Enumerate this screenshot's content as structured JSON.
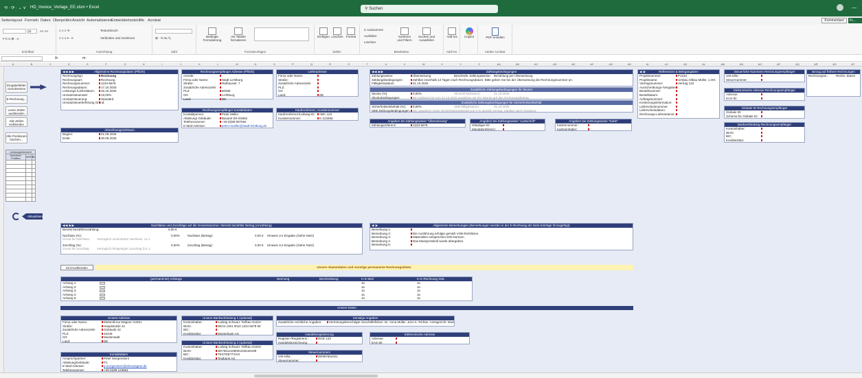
{
  "window": {
    "quick_access": "⟲ · ⟳ · ⌄ ∨",
    "filename": "HD_Invoice_Vorlage_EE.xlsm • Excel",
    "search_placeholder": "Suchen",
    "minimize": "—"
  },
  "menu": [
    "Seitenlayout",
    "Formeln",
    "Daten",
    "Überprüfen",
    "Ansicht",
    "Automatisieren",
    "Entwicklertools",
    "Hilfe",
    "Acrobat"
  ],
  "menu_right": {
    "kommentare": "Kommentare",
    "freigeben": "Fr..."
  },
  "ribbon": {
    "groups": [
      {
        "label": "Schriftart"
      },
      {
        "label": "Ausrichtung"
      },
      {
        "label": "Zahl"
      },
      {
        "label": "Formatvorlagen"
      },
      {
        "label": "Zellen"
      },
      {
        "label": "Bearbeiten"
      },
      {
        "label": "Add-Ins"
      },
      {
        "label": "Adobe Acrobat"
      }
    ],
    "font_size": "11",
    "textumbruch": "Textumbruch",
    "verbinden": "Verbinden und zentrieren",
    "bedingte": "Bedingte Formatierung",
    "als_tabelle": "Als Tabelle formatieren",
    "einfuegen": "Einfügen",
    "loeschen": "Löschen",
    "format": "Format",
    "autosumme": "Autosumme",
    "ausfuellen": "Ausfüllen",
    "loeschen2": "Löschen",
    "sortieren": "Sortieren und Filtern",
    "suchen": "Suchen und Auswählen",
    "addins": "Add-Ins",
    "copilot": "Copilot",
    "pdf": "PDF erstellen"
  },
  "formula": {
    "namebox": "",
    "fx": "fx",
    "value": "m"
  },
  "columns": [
    "A",
    "B",
    "C",
    "D",
    "E",
    "F",
    "G",
    "H",
    "I",
    "J",
    "K",
    "L",
    "M",
    "N",
    "O",
    "P",
    "Q",
    "R",
    "S",
    "T",
    "U",
    "V",
    "W",
    "X",
    "Y",
    "Z",
    "AA",
    "AB",
    "AC",
    "AD",
    "AE",
    "AF",
    "AG",
    "AH",
    "AI",
    "AJ",
    "AK",
    "AL",
    "AM",
    "AN",
    "AO",
    "AP",
    "AQ",
    "AR",
    "AS",
    "AT"
  ],
  "sidebuttons": {
    "eingabefelder": "Eingabefelder zurücksetzen",
    "erechnung": "E-Rechnung...",
    "leere_zeilen": "Leere Zeilen ausblenden",
    "alle_zeilen": "Alle Zeilen einblenden",
    "alle_positionen": "Alle Positionen löschen...",
    "aktualisieren": "Aktualisieren"
  },
  "leistung_table": {
    "title": "Leistungsübersicht",
    "headers": [
      "Gebühren Position",
      "VBR",
      "Bk"
    ]
  },
  "allgemeine": {
    "title": "Allgemeine Rechnungsdaten (Pflicht)",
    "rows": [
      {
        "label": "Rechnungstyp:",
        "value": "Rechnung",
        "bold": true
      },
      {
        "label": "Rechnungsart:",
        "value": "Rechnung"
      },
      {
        "label": "Rechnungsnummer:",
        "value": "1234-5678"
      },
      {
        "label": "Rechnungsdatum:",
        "value": "17.10.2025"
      },
      {
        "label": "Leistungs-/Lieferdatum:",
        "value": "16.10.2025"
      },
      {
        "label": "Umsatzsteuersatz:",
        "value": "19,00%"
      },
      {
        "label": "Umsatzsteuerung:",
        "value": "Standard"
      },
      {
        "label": "Umsatzsteuerbefreiung Grund:",
        "value": ""
      }
    ]
  },
  "abrechnung": {
    "title": "Abrechnungszeitraum",
    "rows": [
      {
        "label": "Beginn:",
        "value": "01.09.2025"
      },
      {
        "label": "Ende:",
        "value": "30.09.2025"
      }
    ]
  },
  "empfaenger": {
    "title": "Rechnungsempfänger Adresse (Pflicht)",
    "rows": [
      {
        "label": "Anrede:",
        "value": ""
      },
      {
        "label": "Firma oder Name:",
        "value": "Stadt Lichtburg"
      },
      {
        "label": "Straße:",
        "value": "Rathausstr. 7"
      },
      {
        "label": "Zusätzliche Adresszeile:",
        "value": ""
      },
      {
        "label": "PLZ:",
        "value": "60486"
      },
      {
        "label": "Ort:",
        "value": "Lichtburg"
      },
      {
        "label": "Land:",
        "value": "DE"
      }
    ]
  },
  "empf_kontakt": {
    "title": "Rechnungsempfänger Kontaktdaten",
    "rows": [
      {
        "label": "Kontaktperson:",
        "value": "Peter Müller"
      },
      {
        "label": "Abteilung/ Gebäude:",
        "value": "Bauamt EK-E5652"
      },
      {
        "label": "Telefonnummer:",
        "value": "+49 (0)89 987654"
      },
      {
        "label": "E-Mail-Adresse:",
        "value": "peter.mueller@stadt-lichtburg.de",
        "link": true
      }
    ]
  },
  "liefer": {
    "title": "Lieferadresse",
    "rows": [
      {
        "label": "Firma oder Name:",
        "value": ""
      },
      {
        "label": "Straße:",
        "value": ""
      },
      {
        "label": "Zusätzliche Adresszeile:",
        "value": ""
      },
      {
        "label": "PLZ:",
        "value": ""
      },
      {
        "label": "Ort:",
        "value": ""
      },
      {
        "label": "Land:",
        "value": "DE"
      }
    ]
  },
  "kaeuferref": {
    "title": "Käuferreferenz, Kundennummer",
    "rows": [
      {
        "label": "Käuferreferenz/Leitweg-ID:",
        "value": "ABC-123"
      },
      {
        "label": "Kundennummer:",
        "value": "K-123456"
      }
    ]
  },
  "zahlung": {
    "title": "Zahlungsbedingungen",
    "rows": [
      {
        "label": "Zahlungsweise:",
        "value": "Überweisung",
        "extra_label": "Beschreib. Zahlungsweise:",
        "extra": "Bezahlung per Überweisung"
      },
      {
        "label": "Zahlungsbedingungen:",
        "value": "Zahlbar innerhalb 14 Tagen nach Rechnungsdatum. Bitte geben Sie bei der Überweisung die Rechnungsnummer an."
      },
      {
        "label": "Fälligkeitsdatum:",
        "value": "31.10.2025"
      }
    ]
  },
  "skonto": {
    "title": "Zusätzliche Zahlungsbedingungen für Skonto",
    "rows": [
      {
        "label": "Skonto (%):",
        "value": "0,00%",
        "grey": "Skontofrist(Datum):",
        "grey2": "31.10.2025"
      },
      {
        "label": "Skontobedingungen:",
        "value": "Bei Zahlung bis zum 31.10.2025 gewähren wir 0% Skonto auf den Rechnungsbetrag.",
        "greyval": true
      }
    ]
  },
  "sicherheit": {
    "title": "Zusätzliche Zahlungsbedingungen für Sicherheitseinbehalt",
    "rows": [
      {
        "label": "Sicherheitseinbehalt (%):",
        "value": "0,00%",
        "grey": "SEB fällig(Datum):",
        "grey2": "31.10.2025"
      },
      {
        "label": "SEB Zahlungsbedingungen:",
        "value": "Wir gewähren einen Sicherheitseinbehalt von 0 % gemäß Vertrag. Zahlbar nach Abnahme.",
        "greyval": true
      }
    ]
  },
  "ueberweisung": {
    "title": "Angaben bei Zahlungsweise \"Überweisung\"",
    "rows": [
      {
        "label": "Zahlungsreferenz:",
        "value": "1234-5678"
      }
    ]
  },
  "lastschrift": {
    "title": "Angaben bei Zahlungsweise \"Lastschrift\"",
    "rows": [
      {
        "label": "Gläubiger-ID:",
        "value": ""
      },
      {
        "label": "Mandatsreferenz:",
        "value": ""
      }
    ]
  },
  "karte": {
    "title": "Angaben bei Zahlungsweise \"Karte\"",
    "rows": [
      {
        "label": "Kartennummer:",
        "value": ""
      },
      {
        "label": "Karteninhaber:",
        "value": ""
      }
    ]
  },
  "referenzen": {
    "title": "Referenzen & Belegangaben",
    "rows": [
      {
        "label": "Projektnummer:",
        "value": "P1234"
      },
      {
        "label": "Projektname:",
        "value": "Umbau Altbau Müller, 1.OG"
      },
      {
        "label": "Vertragsnummer:",
        "value": "Vertrag 123"
      },
      {
        "label": "Ausschreibungs-/Vergabenr.:",
        "value": ""
      },
      {
        "label": "Bestellnummer:",
        "value": ""
      },
      {
        "label": "Bestelldatum:",
        "value": ""
      },
      {
        "label": "Auftragsnummer:",
        "value": ""
      },
      {
        "label": "Kontierungsinformation:",
        "value": ""
      },
      {
        "label": "Lieferscheinnummer:",
        "value": ""
      },
      {
        "label": "Lieferscheindatum:",
        "value": ""
      },
      {
        "label": "Rechnungs-Lieferantennr.:",
        "value": ""
      }
    ]
  },
  "steuernummern": {
    "title": "Steuerliche Nummern Rechnungsempfänger",
    "rows": [
      {
        "label": "USt-IdNr.:",
        "value": ""
      },
      {
        "label": "Steuernummer:",
        "value": ""
      }
    ]
  },
  "elektronische": {
    "title": "Elektronische Adresse Rechnungsempfänger",
    "rows": [
      {
        "label": "Adresse:",
        "value": ""
      },
      {
        "label": "EAS-ID:",
        "value": ""
      }
    ]
  },
  "globalid": {
    "title": "Globale ID Rechnungsempfänger",
    "rows": [
      {
        "label": "Globale ID:",
        "value": ""
      },
      {
        "label": "Schema für Globale ID:",
        "value": ""
      }
    ]
  },
  "bankverbindung_empf": {
    "title": "Bankverbindung Rechnungsempfänger",
    "rows": [
      {
        "label": "Kontoinhaber:",
        "value": ""
      },
      {
        "label": "IBAN:",
        "value": ""
      },
      {
        "label": "BIC:",
        "value": ""
      },
      {
        "label": "Kreditinstitut:",
        "value": ""
      }
    ]
  },
  "bezug": {
    "title": "Bezug auf frühere Rechnungen",
    "headers": [
      "Rechnungsnr.:",
      "Rechn.-datum"
    ]
  },
  "nachlass": {
    "title": "Nachlässe und Zuschläge auf die Gesamtsumme / Bereits bezahlter Betrag (Anzahlung)",
    "bereits_label": "Bereits bezahlt/Anzahlung:",
    "bereits_value": "0,00 €",
    "nachlass_label": "Nachlass (%):",
    "nachlass_pct": "0,00%",
    "nachlass_betrag_label": "Nachlass (Betrag):",
    "nachlass_betrag": "0,00 €",
    "hinweis": "Hinweis zur Eingabe (Siehe Notiz)",
    "grund_nachlass_label": "Grund für Nachlass:",
    "grund_nachlass": "Vertraglich vereinbarter Nachlass: 12.1",
    "zuschlag_label": "Zuschlag (%):",
    "zuschlag_pct": "0,00%",
    "zuschlag_betrag_label": "Zuschlag (Betrag):",
    "zuschlag_betrag": "0,00 €",
    "hinweis2": "Hinweis zur Eingabe (Siehe Notiz)",
    "grund_zuschlag_label": "Grund für Zuschlag:",
    "grund_zuschlag": "Vertraglich festgelegter Zuschlag §11.1"
  },
  "bemerkungen": {
    "title": "Allgemeine Bemerkungen (Bemerkungen werden in der E-Rechnung als Note-Einträge hinzugefügt)",
    "rows": [
      {
        "label": "Bemerkung 1:",
        "value": ""
      },
      {
        "label": "Bemerkung 2:",
        "value": "Die Ausführung erfolgte gemäß VOB-Richtlinien."
      },
      {
        "label": "Bemerkung 3:",
        "value": "Materialien entsprechen DIN-Normen."
      },
      {
        "label": "Bemerkung 4:",
        "value": "Das Massprotokoll wurde übergeben."
      },
      {
        "label": "Bemerkung 5:",
        "value": ""
      }
    ]
  },
  "einaus": "Ein/Ausblenden",
  "stammdaten_banner": "Unsere Stammdaten und sonstige permanente Rechnungsdaten",
  "anlagen": {
    "headers": [
      "(permanente) Anhänge",
      "Nennung",
      "Beschreibung",
      "In E-Mail",
      "In E-Rechnung XML"
    ],
    "rows": [
      {
        "label": "Anhang 1:",
        "email": "Ja",
        "xml": "Ja"
      },
      {
        "label": "Anhang 2:",
        "email": "Ja",
        "xml": "Ja"
      },
      {
        "label": "Anhang 3:",
        "email": "Ja",
        "xml": "Ja"
      },
      {
        "label": "Anhang 4:",
        "email": "Ja",
        "xml": "Ja"
      },
      {
        "label": "Anhang 5:",
        "email": "Ja",
        "xml": "Ja"
      }
    ]
  },
  "unsere_daten_banner": "Unsere Daten",
  "unsere_adresse": {
    "title": "Unsere Adresse",
    "rows": [
      {
        "label": "Firma oder Name:",
        "value": "Elektrofirma Wagner GmbH"
      },
      {
        "label": "Straße:",
        "value": "Hauptstraße 42"
      },
      {
        "label": "Zusätzliche Adresszeile:",
        "value": "Gebäude 42"
      },
      {
        "label": "PLZ:",
        "value": "10445"
      },
      {
        "label": "Ort:",
        "value": "Musterstadt"
      },
      {
        "label": "Land:",
        "value": "DE"
      }
    ]
  },
  "kontaktdaten": {
    "title": "Kontaktdaten",
    "rows": [
      {
        "label": "Ansprechpartner:",
        "value": "Peter Morgenstern"
      },
      {
        "label": "Abteilung/Gebäude:",
        "value": "P1"
      },
      {
        "label": "E-Mail-Adresse:",
        "value": "p.morgenstern@elecwagner.de",
        "link": true
      },
      {
        "label": "Telefonnummer:",
        "value": "+49 (0)89 123654"
      }
    ]
  },
  "bank1": {
    "title": "Unsere Bankverbindung 1 (optional)",
    "rows": [
      {
        "label": "Kontoinhaber:",
        "value": "Ludwig Schwarz Tiefbau GmbH"
      },
      {
        "label": "IBAN:",
        "value": "DE44 1001 0010 1234 5678 90"
      },
      {
        "label": "BIC:",
        "value": ""
      },
      {
        "label": "Kreditinstitut:",
        "value": "Musterbank AG"
      }
    ]
  },
  "bank2": {
    "title": "Unsere Bankverbindung 2 (optional)",
    "rows": [
      {
        "label": "Kontoinhaber:",
        "value": "Ludwig Schwarz Tiefbau GmbH"
      },
      {
        "label": "IBAN:",
        "value": "DE75512108001245126199"
      },
      {
        "label": "BIC:",
        "value": "TESTDETTXXX"
      },
      {
        "label": "Kreditinstitut:",
        "value": "Testbank AG"
      }
    ]
  },
  "sonstige": {
    "title": "Sonstige Angaben",
    "rows": [
      {
        "label": "Zusätzliche rechtliche Angaben:",
        "value": "Vertretungsberechtigte Geschäftsführer: Dr. Anna Müller, Jens K. Richter. Amtsgericht: Musterstadt"
      }
    ]
  },
  "handelsreg": {
    "title": "Handelsregistrierung",
    "rows": [
      {
        "label": "Register-/Registriernr.:",
        "value": "DGD 123"
      },
      {
        "label": "Handelsbezeichnung:",
        "value": ""
      }
    ]
  },
  "elektr_adresse": {
    "title": "Elektronische Adresse",
    "rows": [
      {
        "label": "Adresse:",
        "value": ""
      },
      {
        "label": "EAS-ID:",
        "value": ""
      }
    ]
  },
  "steuern_unsere": {
    "title": "Steuernummern",
    "rows": [
      {
        "label": "USt-IdNr.:",
        "value": "DE987654321"
      },
      {
        "label": "Steuernummer:",
        "value": ""
      }
    ]
  }
}
